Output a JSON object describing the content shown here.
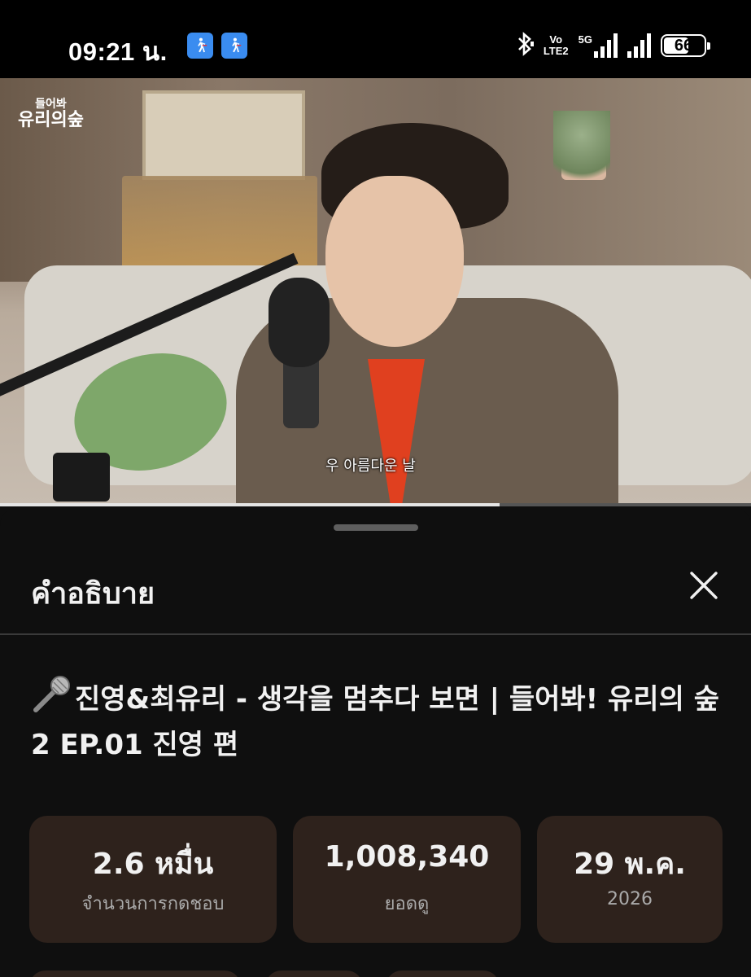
{
  "status_bar": {
    "time": "09:21 น.",
    "volte_top": "Vo",
    "volte_bottom": "LTE2",
    "network": "5G",
    "battery": "66",
    "battery_level": 0.66
  },
  "video": {
    "logo_line1": "들어봐",
    "logo_line2": "유리의숲",
    "subtitle": "우 아름다운 날",
    "progress": 0.665
  },
  "sheet": {
    "title": "คำอธิบาย",
    "close_icon": "close-icon"
  },
  "video_title": "진영&최유리 - 생각을 멈추다 보면 | 들어봐! 유리의 숲2 EP.01 진영 편",
  "stats": {
    "likes_value": "2.6 หมื่น",
    "likes_label": "จำนวนการกดชอบ",
    "views_value": "1,008,340",
    "views_label": "ยอดดู",
    "date_value": "29 พ.ค.",
    "date_year": "2026"
  },
  "colors": {
    "background": "#0f0f0f",
    "stat_card": "#2e221c",
    "status_icon_blue": "#3a8cf0"
  }
}
